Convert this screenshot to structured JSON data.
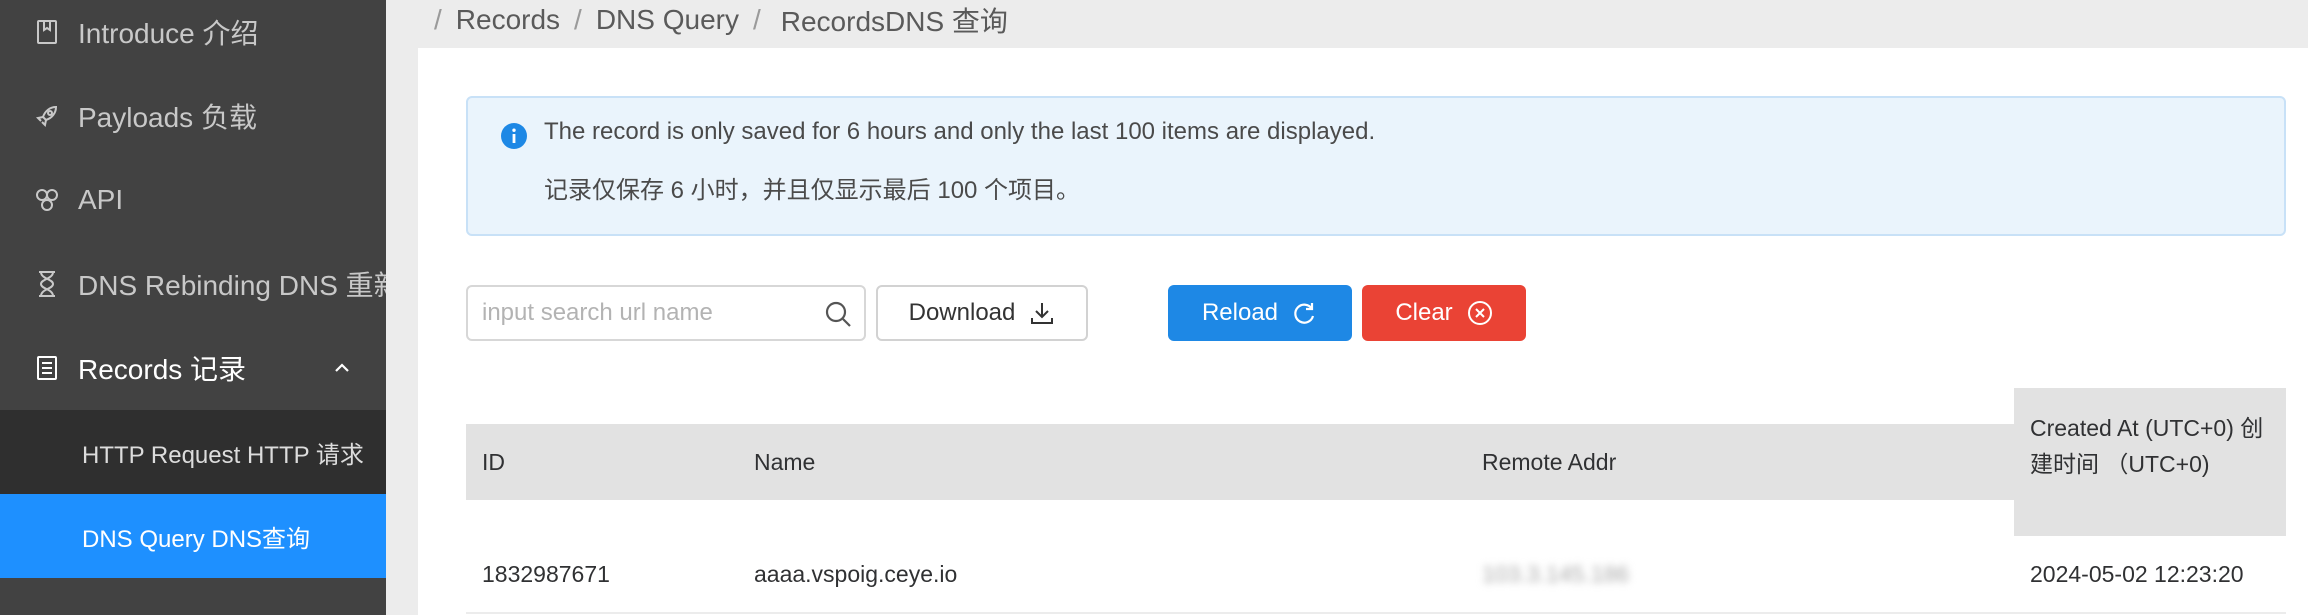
{
  "sidebar": {
    "items": [
      {
        "label": "Introduce 介绍",
        "icon": "book-icon"
      },
      {
        "label": "Payloads 负载",
        "icon": "rocket-icon"
      },
      {
        "label": "API",
        "icon": "api-icon"
      },
      {
        "label": "DNS Rebinding DNS 重新绑定",
        "icon": "hourglass-icon"
      },
      {
        "label": "Records 记录",
        "icon": "records-icon",
        "expanded": true
      }
    ],
    "submenu": [
      {
        "label": "HTTP Request HTTP 请求",
        "active": false
      },
      {
        "label": "DNS Query DNS查询",
        "active": true
      }
    ]
  },
  "breadcrumb": {
    "items": [
      "Records",
      "DNS Query",
      "RecordsDNS 查询"
    ]
  },
  "alert": {
    "line1": "The record is only saved for 6 hours and only the last 100 items are displayed.",
    "line2": "记录仅保存 6 小时，并且仅显示最后 100 个项目。"
  },
  "toolbar": {
    "search_placeholder": "input search url name",
    "search_value": "",
    "download_label": "Download",
    "reload_label": "Reload",
    "clear_label": "Clear"
  },
  "table": {
    "columns": [
      "ID",
      "Name",
      "Remote Addr",
      "Created At (UTC+0) 创建时间 （UTC+0)"
    ],
    "rows": [
      {
        "id": "1832987671",
        "name": "aaaa.vspoig.ceye.io",
        "remote_addr": "103.3.145.186",
        "created_at": "2024-05-02 12:23:20"
      }
    ]
  },
  "colors": {
    "sidebar_bg": "#424242",
    "submenu_bg": "#2f2f2f",
    "active_bg": "#1e90ff",
    "reload_bg": "#1e88e5",
    "clear_bg": "#ea4335",
    "alert_bg": "#eaf4fc"
  }
}
